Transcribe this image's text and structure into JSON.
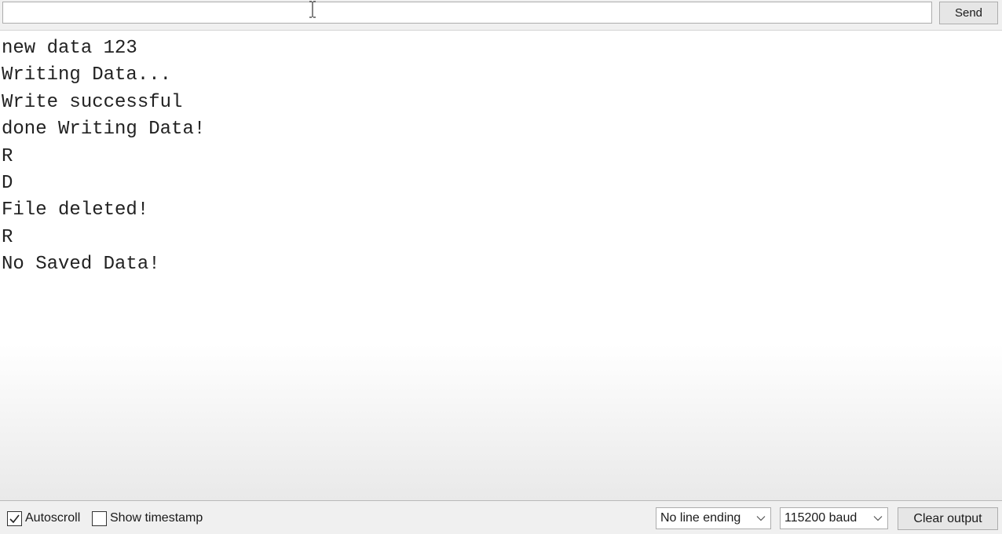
{
  "input": {
    "value": "",
    "send_label": "Send"
  },
  "output": {
    "lines": [
      "new data 123",
      "Writing Data...",
      "Write successful",
      "done Writing Data!",
      "R",
      "D",
      "File deleted!",
      "R",
      "No Saved Data!"
    ]
  },
  "footer": {
    "autoscroll_label": "Autoscroll",
    "autoscroll_checked": true,
    "timestamp_label": "Show timestamp",
    "timestamp_checked": false,
    "line_ending": "No line ending",
    "baud": "115200 baud",
    "clear_label": "Clear output"
  },
  "icons": {
    "check": "checkmark-icon",
    "chevron": "chevron-down-icon",
    "cursor": "text-cursor-icon"
  }
}
